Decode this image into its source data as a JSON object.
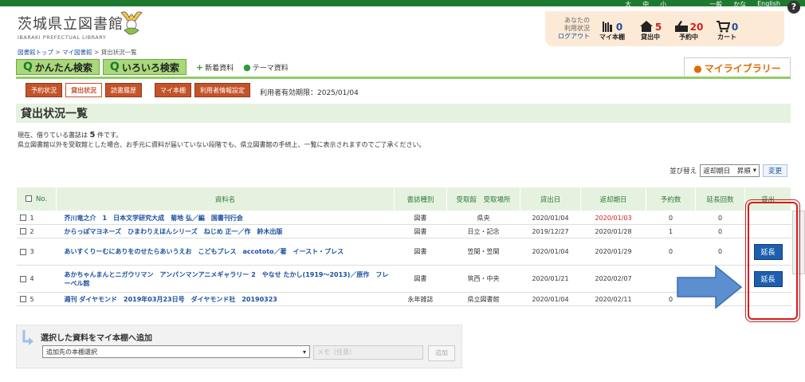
{
  "top_links": [
    "大",
    "中",
    "小",
    "一般",
    "かな",
    "English"
  ],
  "help_label": "?",
  "logo": {
    "title": "茨城県立図書館",
    "subtitle": "IBARAKI PREFECTUAL LIBRARY"
  },
  "status": {
    "user_line1": "あなたの",
    "user_line2": "利用状況",
    "logout": "ログアウト",
    "items": [
      {
        "label": "マイ本棚",
        "count": "0",
        "icon": "bookshelf-icon"
      },
      {
        "label": "貸出中",
        "count": "5",
        "icon": "house-icon"
      },
      {
        "label": "予約中",
        "count": "20",
        "icon": "reserve-icon"
      },
      {
        "label": "カート",
        "count": "0",
        "icon": "cart-icon"
      }
    ]
  },
  "breadcrumb": {
    "home": "図書館トップ",
    "sep": " > ",
    "mypage": "マイ図書館",
    "current": "貸出状況一覧"
  },
  "search": {
    "simple": "かんたん検索",
    "advanced": "いろいろ検索",
    "new": "新着資料",
    "theme": "テーマ資料"
  },
  "mylibrary": "マイライブラリー",
  "tabs": {
    "reserve": "予約状況",
    "loan": "貸出状況",
    "history": "読書履歴",
    "shelf": "マイ本棚",
    "settings": "利用者情報設定"
  },
  "expiry": "利用者有効期限：2025/01/04",
  "page_title": "貸出状況一覧",
  "notice": {
    "line1_pre": "現在、借りている書誌は ",
    "count": "5",
    "line1_post": " 件です。",
    "line2": "県立図書館以外を受取館とした場合、お手元に資料が届いていない段階でも、県立図書館の手続上、一覧に表示されますのでご了承ください。"
  },
  "sort": {
    "label": "並び替え",
    "selected": "返却期日　昇順",
    "button": "変更"
  },
  "table": {
    "headers": {
      "no": "No.",
      "title": "資料名",
      "type": "書誌種別",
      "place": "受取館　受取場所",
      "loan_date": "貸出日",
      "due": "返却期日",
      "reservations": "予約数",
      "extensions": "延長回数",
      "action": "貸出"
    },
    "rows": [
      {
        "no": "1",
        "title": "芥川竜之介　1　日本文学研究大成　菊地 弘／編　国書刊行会",
        "type": "図書",
        "place": "県央",
        "loan_date": "2020/01/04",
        "due": "2020/01/03",
        "reservations": "0",
        "extensions": "0",
        "action": ""
      },
      {
        "no": "2",
        "title": "からっぽマヨネーズ　ひまわりえほんシリーズ　ねじめ 正一／作　鈴木出版",
        "type": "図書",
        "place": "日立・記念",
        "loan_date": "2019/12/27",
        "due": "2020/01/28",
        "reservations": "1",
        "extensions": "0",
        "action": ""
      },
      {
        "no": "3",
        "title": "あいすくりーむにありをのせたらあいうえお　こどもプレス　accototo／著　イースト・プレス",
        "type": "図書",
        "place": "笠間・笠間",
        "loan_date": "2020/01/04",
        "due": "2020/01/29",
        "reservations": "0",
        "extensions": "0",
        "action": "延長"
      },
      {
        "no": "4",
        "title": "あかちゃんまんとニガウリマン　アンパンマンアニメギャラリー 2　やなせ たかし(1919～2013)／原作　フレーベル館",
        "type": "図書",
        "place": "筑西・中央",
        "loan_date": "2020/01/21",
        "due": "2020/02/07",
        "reservations": "",
        "extensions": "",
        "action": "延長"
      },
      {
        "no": "5",
        "title": "週刊 ダイヤモンド　2019年03月23日号　ダイヤモンド社　20190323",
        "type": "永年雑誌",
        "place": "県立図書館",
        "loan_date": "2020/01/04",
        "due": "2020/02/11",
        "reservations": "0",
        "extensions": "1",
        "action": ""
      }
    ]
  },
  "add_to_shelf": {
    "label": "選択した資料をマイ本棚へ追加",
    "select": "追加先の本棚選択",
    "memo_placeholder": "メモ（任意）",
    "button": "追加"
  },
  "colors": {
    "brand_green": "#1e7a2e",
    "tab_orange": "#c4532a",
    "link_blue": "#1a4fa0",
    "highlight_red": "#d41d1d",
    "arrow_blue": "#5b8fd0"
  }
}
